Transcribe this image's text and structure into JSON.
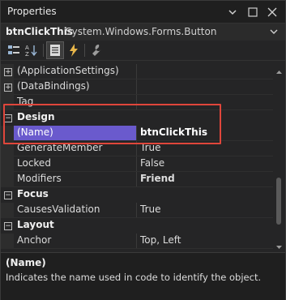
{
  "window": {
    "title": "Properties"
  },
  "object": {
    "name": "btnClickThis",
    "type": "System.Windows.Forms.Button"
  },
  "toolbar": {
    "items": [
      "categorized-view-icon",
      "alphabetical-view-icon",
      "properties-icon",
      "events-icon",
      "property-pages-icon"
    ]
  },
  "grid": {
    "rows": [
      {
        "kind": "collapsed",
        "name": "(ApplicationSettings)",
        "value": ""
      },
      {
        "kind": "collapsed",
        "name": "(DataBindings)",
        "value": ""
      },
      {
        "kind": "prop",
        "name": "Tag",
        "value": ""
      },
      {
        "kind": "category",
        "name": "Design"
      },
      {
        "kind": "selected",
        "name": "(Name)",
        "value": "btnClickThis"
      },
      {
        "kind": "prop",
        "name": "GenerateMember",
        "value": "True"
      },
      {
        "kind": "prop",
        "name": "Locked",
        "value": "False"
      },
      {
        "kind": "propbold",
        "name": "Modifiers",
        "value": "Friend"
      },
      {
        "kind": "category",
        "name": "Focus"
      },
      {
        "kind": "prop",
        "name": "CausesValidation",
        "value": "True"
      },
      {
        "kind": "category",
        "name": "Layout"
      },
      {
        "kind": "prop",
        "name": "Anchor",
        "value": "Top, Left"
      }
    ]
  },
  "description": {
    "title": "(Name)",
    "text": "Indicates the name used in code to identify the object."
  },
  "colors": {
    "accent": "#6a5acd",
    "highlight": "#e0463b"
  }
}
